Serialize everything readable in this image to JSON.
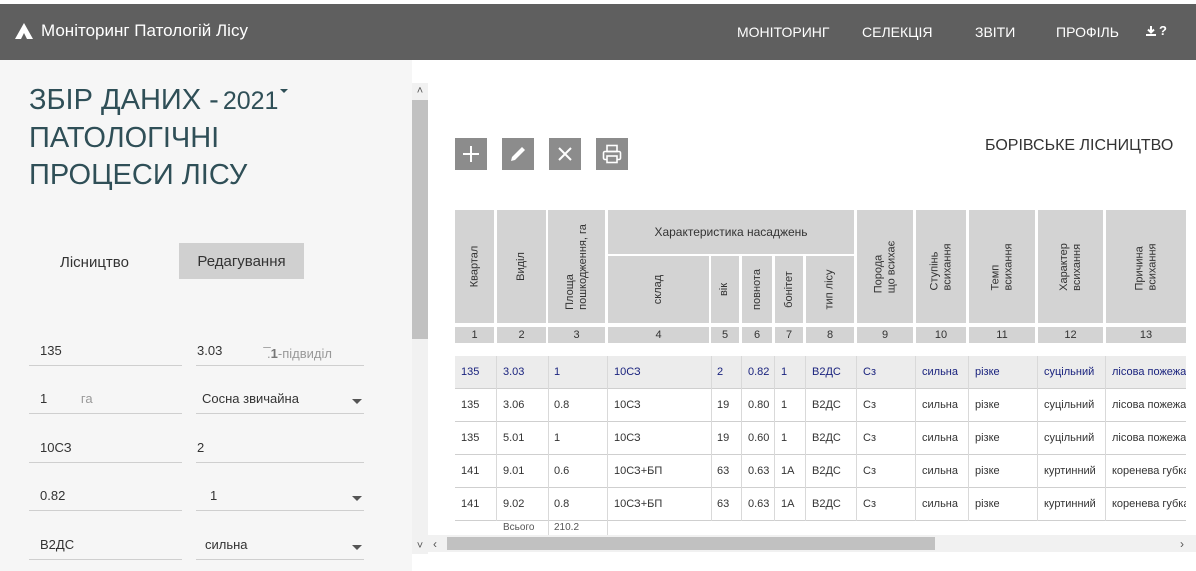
{
  "app": {
    "title": "Моніторинг Патологій Лісу",
    "nav": [
      "МОНІТОРИНГ",
      "СЕЛЕКЦІЯ",
      "ЗВІТИ",
      "ПРОФІЛЬ"
    ],
    "download_icon": "download-icon",
    "help_label": "?"
  },
  "page": {
    "title_prefix": "ЗБІР ДАНИХ -",
    "year": "2021",
    "title_line2": "ПАТОЛОГІЧНІ",
    "title_line3": "ПРОЦЕСИ ЛІСУ",
    "tab_forestry": "Лісництво",
    "tab_edit": "Редагування"
  },
  "form": {
    "quarter": "135",
    "subplot": "3.03",
    "subplot_hint_prefix": "̅.",
    "subplot_hint_bold": "1",
    "subplot_hint": "-підвиділ",
    "area": "1",
    "area_unit": "га",
    "species": "Сосна звичайна",
    "composition": "10СЗ",
    "age": "2",
    "density": "0.82",
    "bonitet": "1",
    "forest_type": "В2ДС",
    "degree": "сильна"
  },
  "forestry_name": "БОРІВСЬКЕ ЛІСНИЦТВО",
  "toolbar": {
    "add_icon": "plus-icon",
    "edit_icon": "pencil-icon",
    "delete_icon": "close-icon",
    "print_icon": "printer-icon"
  },
  "table": {
    "group_header": "Характеристика насаджень",
    "headers": [
      "Квартал",
      "Виділ",
      "Площа пошкодження, га",
      "склад",
      "вік",
      "повнота",
      "бонітет",
      "тип лісу",
      "Порода що всихає",
      "Ступінь всихання",
      "Темп всихання",
      "Характер всихання",
      "Причина всихання"
    ],
    "header_lines": [
      [
        "Квартал"
      ],
      [
        "Виділ"
      ],
      [
        "Площа",
        "пошкодження, га"
      ],
      [
        "склад"
      ],
      [
        "вік"
      ],
      [
        "повнота"
      ],
      [
        "бонітет"
      ],
      [
        "тип лісу"
      ],
      [
        "Порода",
        "що всихає"
      ],
      [
        "Ступінь",
        "всихання"
      ],
      [
        "Темп",
        "всихання"
      ],
      [
        "Характер",
        "всихання"
      ],
      [
        "Причина",
        "всихання"
      ]
    ],
    "numbers": [
      "1",
      "2",
      "3",
      "4",
      "5",
      "6",
      "7",
      "8",
      "9",
      "10",
      "11",
      "12",
      "13"
    ],
    "rows": [
      [
        "135",
        "3.03",
        "1",
        "10СЗ",
        "2",
        "0.82",
        "1",
        "В2ДС",
        "Сз",
        "сильна",
        "різке",
        "суцільний",
        "лісова пожежа"
      ],
      [
        "135",
        "3.06",
        "0.8",
        "10СЗ",
        "19",
        "0.80",
        "1",
        "В2ДС",
        "Сз",
        "сильна",
        "різке",
        "суцільний",
        "лісова пожежа"
      ],
      [
        "135",
        "5.01",
        "1",
        "10СЗ",
        "19",
        "0.60",
        "1",
        "В2ДС",
        "Сз",
        "сильна",
        "різке",
        "суцільний",
        "лісова пожежа"
      ],
      [
        "141",
        "9.01",
        "0.6",
        "10СЗ+БП",
        "63",
        "0.63",
        "1А",
        "В2ДС",
        "Сз",
        "сильна",
        "різке",
        "куртинний",
        "коренева губка"
      ],
      [
        "141",
        "9.02",
        "0.8",
        "10СЗ+БП",
        "63",
        "0.63",
        "1А",
        "В2ДС",
        "Сз",
        "сильна",
        "різке",
        "куртинний",
        "коренева губка"
      ]
    ],
    "total_label": "Всього",
    "total_value": "210.2"
  }
}
